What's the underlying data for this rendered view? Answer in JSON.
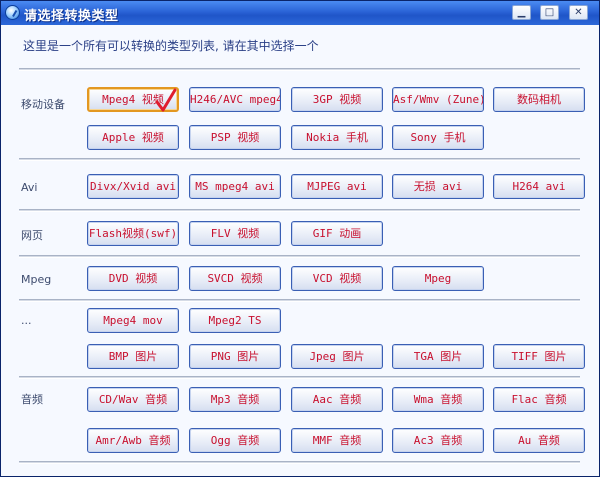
{
  "window": {
    "title": "请选择转换类型",
    "min_icon": "minimize-icon",
    "max_icon": "maximize-icon",
    "close_icon": "close-icon"
  },
  "description": "这里是一个所有可以转换的类型列表, 请在其中选择一个",
  "categories": {
    "mobile": "移动设备",
    "avi": "Avi",
    "web": "网页",
    "mpeg": "Mpeg",
    "more": "...",
    "audio": "音频"
  },
  "buttons": {
    "mpeg4_video": "Mpeg4 视频",
    "h246_avc": "H246/AVC mpeg4",
    "3gp_video": "3GP 视频",
    "asf_wmv": "Asf/Wmv (Zune)",
    "digital_camera": "数码相机",
    "apple_video": "Apple 视频",
    "psp_video": "PSP 视频",
    "nokia_phone": "Nokia 手机",
    "sony_phone": "Sony 手机",
    "divx_xvid": "Divx/Xvid avi",
    "ms_mpeg4": "MS mpeg4 avi",
    "mjpeg_avi": "MJPEG avi",
    "lossless_avi": "无损 avi",
    "h264_avi": "H264 avi",
    "flash_swf": "Flash视频(swf)",
    "flv_video": "FLV 视频",
    "gif_anim": "GIF 动画",
    "dvd_video": "DVD 视频",
    "svcd_video": "SVCD 视频",
    "vcd_video": "VCD 视频",
    "mpeg": "Mpeg",
    "mpeg4_mov": "Mpeg4 mov",
    "mpeg2_ts": "Mpeg2 TS",
    "bmp_image": "BMP 图片",
    "png_image": "PNG 图片",
    "jpeg_image": "Jpeg 图片",
    "tga_image": "TGA 图片",
    "tiff_image": "TIFF 图片",
    "cd_wav": "CD/Wav 音频",
    "mp3_audio": "Mp3 音频",
    "aac_audio": "Aac 音频",
    "wma_audio": "Wma 音频",
    "flac_audio": "Flac 音频",
    "amr_awb": "Amr/Awb 音频",
    "ogg_audio": "Ogg 音频",
    "mmf_audio": "MMF 音频",
    "ac3_audio": "Ac3 音频",
    "au_audio": "Au 音频"
  },
  "selected_icon": "checkmark-icon",
  "colors": {
    "title_bar": "#2a63d6",
    "button_text": "#c8102e",
    "selected_border": "#e39821",
    "description_text": "#2a3f86"
  }
}
